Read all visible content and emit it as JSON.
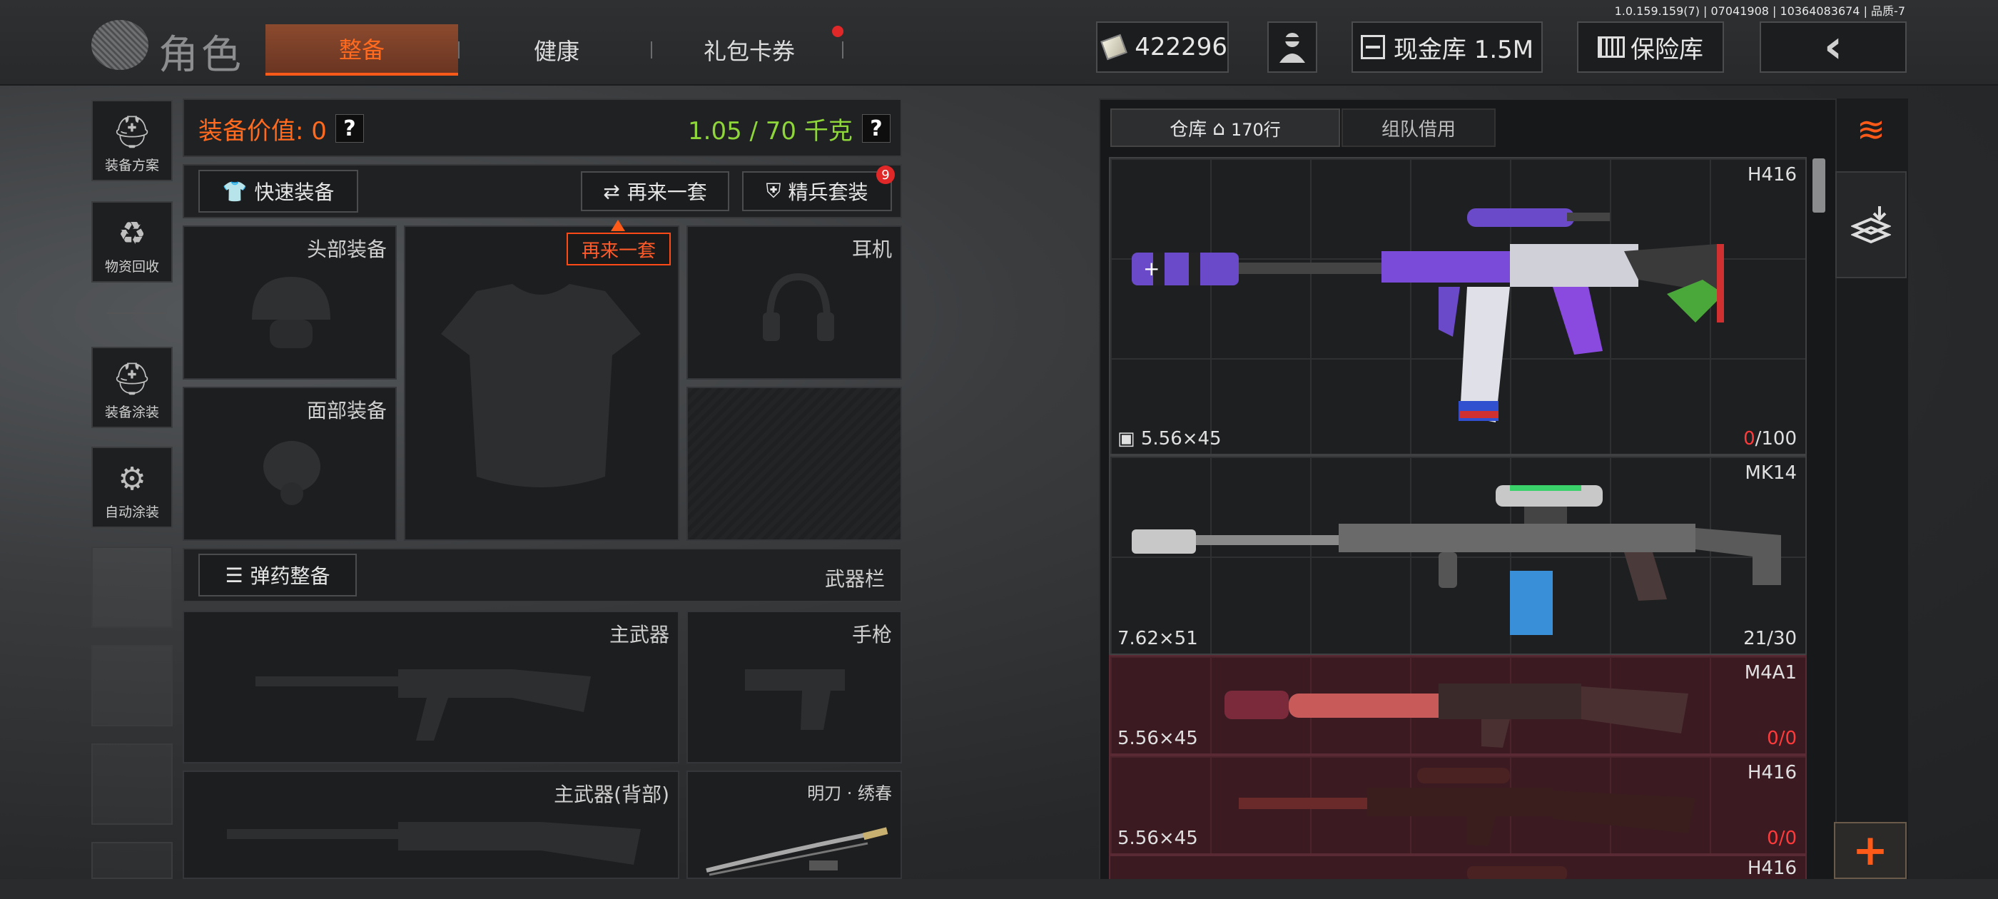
{
  "build_info": "1.0.159.159(7) | 07041908 | 10364083674 | 品质-7",
  "header": {
    "title": "角色",
    "tabs": [
      {
        "label": "整备",
        "active": true
      },
      {
        "label": "健康",
        "active": false
      },
      {
        "label": "礼包卡券",
        "active": false,
        "has_notification": true
      }
    ],
    "currency_value": "422296",
    "cash_vault_label": "现金库 1.5M",
    "safe_box_label": "保险库"
  },
  "left_menu": [
    {
      "label": "装备方案",
      "icon": "helmet-grid-icon"
    },
    {
      "label": "物资回收",
      "icon": "recycle-icon"
    },
    {
      "label": "装备涂装",
      "icon": "helmet-brush-icon"
    },
    {
      "label": "自动涂装",
      "icon": "brush-gear-icon"
    }
  ],
  "loadout": {
    "value_label": "装备价值: 0",
    "weight_label": "1.05 / 70 千克",
    "quick_equip": "快速装备",
    "again_set": "再来一套",
    "elite_set": "精兵套装",
    "elite_badge": "9",
    "tooltip": "再来一套",
    "slots": {
      "head": "头部装备",
      "face": "面部装备",
      "headset": "耳机",
      "primary": "主武器",
      "pistol": "手枪",
      "primary_back": "主武器(背部)",
      "melee": "明刀 · 绣春"
    },
    "ammo_button": "弹药整备",
    "weapon_bar_label": "武器栏"
  },
  "warehouse": {
    "tab_warehouse": "仓库",
    "tab_rows": "170行",
    "tab_team": "组队借用",
    "items": [
      {
        "name": "H416",
        "ammo": "5.56×45",
        "current": "0",
        "max": "/100",
        "red": false
      },
      {
        "name": "MK14",
        "ammo": "7.62×51",
        "current": "21",
        "max": "/30",
        "red": false
      },
      {
        "name": "M4A1",
        "ammo": "5.56×45",
        "current": "0",
        "max": "/0",
        "red": true
      },
      {
        "name": "H416",
        "ammo": "5.56×45",
        "current": "0",
        "max": "/0",
        "red": true
      },
      {
        "name": "H416",
        "ammo": "",
        "current": "",
        "max": "",
        "red": true
      }
    ]
  },
  "colors": {
    "accent": "#ff5a18",
    "weight_green": "#8fd63a",
    "value_orange": "#ff6a1f",
    "alert_red": "#e02828"
  }
}
